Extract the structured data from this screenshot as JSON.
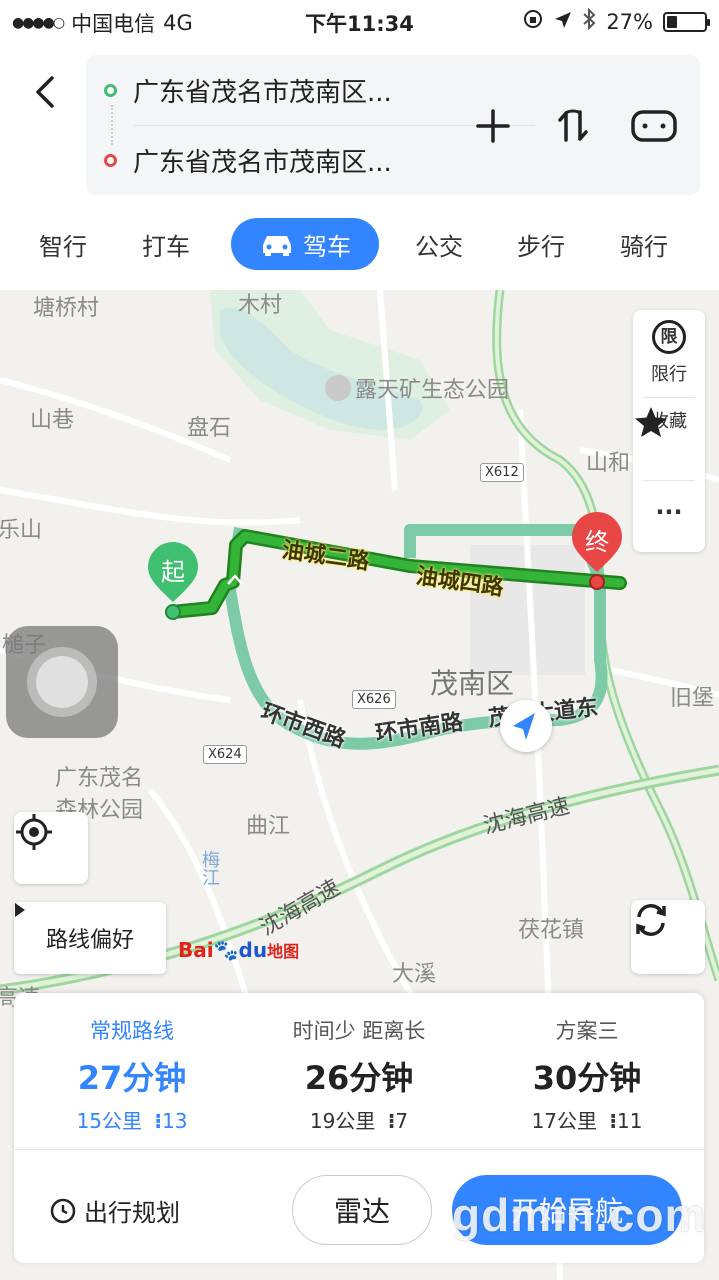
{
  "status_bar": {
    "carrier": "中国电信",
    "network": "4G",
    "time": "下午11:34",
    "battery": "27%",
    "battery_level": 0.27
  },
  "route": {
    "origin": "广东省茂名市茂南区...",
    "destination": "广东省茂名市茂南区..."
  },
  "modes": [
    {
      "label": "智行"
    },
    {
      "label": "打车"
    },
    {
      "label": "驾车"
    },
    {
      "label": "公交"
    },
    {
      "label": "步行"
    },
    {
      "label": "骑行"
    }
  ],
  "active_mode": "驾车",
  "map": {
    "places": {
      "tangqiao": "塘桥村",
      "mucun": "木村",
      "park": "露天矿生态公园",
      "shanxiang": "山巷",
      "panshi": "盘石",
      "shanhe": "山和",
      "leshan": "乐山",
      "tuozi": "槌子",
      "district": "茂南区",
      "jiubao": "旧堡",
      "forest1": "广东茂名",
      "forest2": "森林公园",
      "qujiang": "曲江",
      "meijiang": "梅江",
      "fuhua": "茯花镇",
      "daxi": "大溪",
      "gaosu": "高速"
    },
    "road_badges": [
      "X612",
      "X626",
      "X624"
    ],
    "road_labels": {
      "youcheng2": "油城二路",
      "youcheng4": "油城四路",
      "huanshi_west": "环市西路",
      "huanshi_south": "环市南路",
      "dadao": "茂名大道东"
    },
    "highway": "沈海高速",
    "start_marker": "起",
    "end_marker": "终",
    "baidu_logo": "Bai",
    "baidu_du": "du",
    "baidu_map": "地图"
  },
  "side_panel": {
    "restrict_icon_char": "限",
    "restrict": "限行",
    "favorite": "收藏",
    "more": "···"
  },
  "route_preference": "路线偏好",
  "options": [
    {
      "title": "常规路线",
      "duration": "27分钟",
      "distance": "15公里",
      "lights": "13"
    },
    {
      "title": "时间少  距离长",
      "duration": "26分钟",
      "distance": "19公里",
      "lights": "7"
    },
    {
      "title": "方案三",
      "duration": "30分钟",
      "distance": "17公里",
      "lights": "11"
    }
  ],
  "buttons": {
    "trip_plan": "出行规划",
    "radar": "雷达",
    "navigate": "开始导航"
  },
  "watermark": "gdmin.com",
  "colors": {
    "accent": "#3385ff",
    "route_primary": "#2fa53f",
    "route_alt": "#7ccaa6",
    "start": "#3fbf6f",
    "end": "#e84545"
  }
}
